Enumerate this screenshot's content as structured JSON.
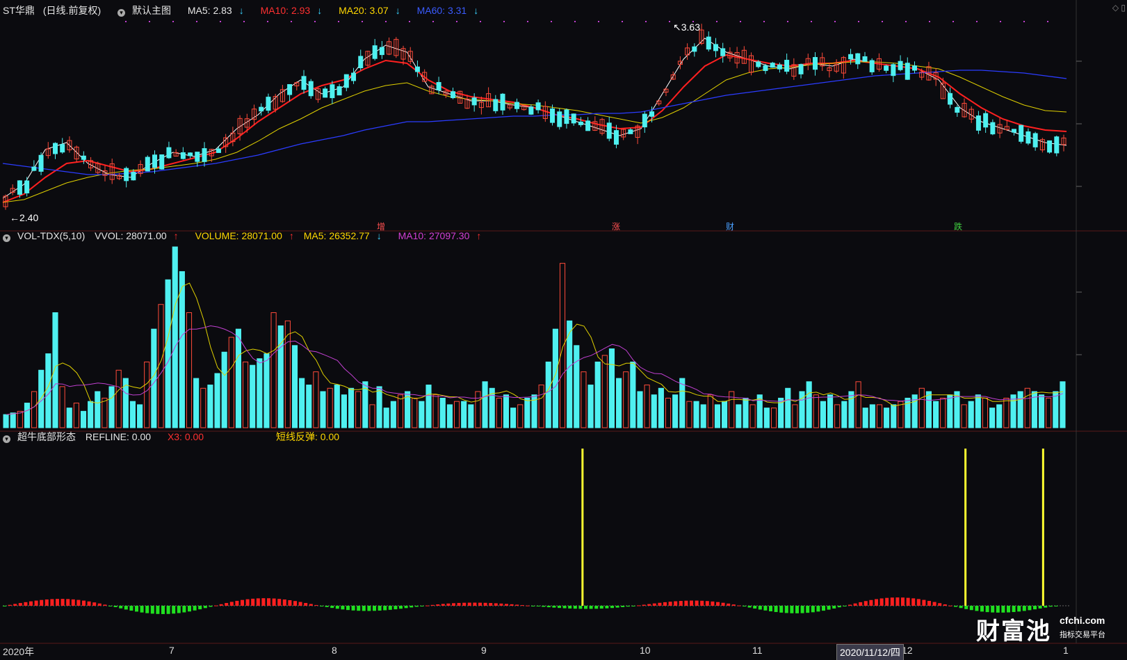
{
  "header_main": {
    "stock": "ST华鼎",
    "period": "(日线.前复权)",
    "template": "默认主图",
    "ma5": "MA5: 2.83",
    "ma10": "MA10: 2.93",
    "ma20": "MA20: 3.07",
    "ma60": "MA60: 3.31"
  },
  "header_vol": {
    "name": "VOL-TDX(5,10)",
    "vvol": "VVOL: 28071.00",
    "volume": "VOLUME: 28071.00",
    "ma5": "MA5: 26352.77",
    "ma10": "MA10: 27097.30"
  },
  "header_ind": {
    "name": "超牛底部形态",
    "refline": "REFLINE: 0.00",
    "x3": "X3: 0.00",
    "rebound": "短线反弹: 0.00"
  },
  "price_labels": {
    "low": "2.40",
    "high": "3.63"
  },
  "event_marks": [
    {
      "text": "增",
      "color": "#ff5050"
    },
    {
      "text": "涨",
      "color": "#ff5050"
    },
    {
      "text": "财",
      "color": "#4aa0ff"
    },
    {
      "text": "跌",
      "color": "#40d040"
    }
  ],
  "x_axis": {
    "year": "2020年",
    "months": [
      "7",
      "8",
      "9",
      "10",
      "11",
      "12",
      "1"
    ]
  },
  "crosshair_date": "2020/11/12/四",
  "watermark": {
    "brand": "财富池",
    "url": "cfchi.com",
    "slogan": "指标交易平台"
  },
  "colors": {
    "up": "#ff4b3a",
    "down": "#4ff0f0",
    "ma5": "#ffffff",
    "ma10": "#ff2020",
    "ma20": "#e0d000",
    "ma60": "#2b3cff",
    "vol_ma5": "#e0d000",
    "vol_ma10": "#c040d0",
    "signal": "#ffff30",
    "osc_pos": "#ff2020",
    "osc_neg": "#20e020"
  },
  "chart_data": [
    {
      "type": "line",
      "name": "main-price-chart",
      "title": "ST华鼎 (日线.前复权)",
      "series": [
        {
          "name": "MA5",
          "values": [
            2.45,
            2.55,
            2.8,
            2.85,
            2.7,
            2.62,
            2.6,
            2.7,
            2.78,
            2.75,
            2.8,
            2.95,
            3.05,
            3.2,
            3.3,
            3.2,
            3.25,
            3.45,
            3.55,
            3.5,
            3.25,
            3.2,
            3.15,
            3.15,
            3.12,
            3.1,
            3.05,
            3.0,
            2.95,
            2.9,
            2.95,
            3.2,
            3.45,
            3.6,
            3.5,
            3.45,
            3.4,
            3.38,
            3.42,
            3.4,
            3.45,
            3.42,
            3.4,
            3.38,
            3.3,
            3.1,
            3.0,
            2.95,
            2.9,
            2.85,
            2.83
          ]
        },
        {
          "name": "MA10",
          "values": [
            2.42,
            2.48,
            2.6,
            2.7,
            2.72,
            2.68,
            2.64,
            2.66,
            2.7,
            2.74,
            2.78,
            2.88,
            3.0,
            3.1,
            3.2,
            3.26,
            3.3,
            3.38,
            3.44,
            3.42,
            3.3,
            3.22,
            3.18,
            3.16,
            3.14,
            3.1,
            3.05,
            3.02,
            2.98,
            2.95,
            2.96,
            3.08,
            3.25,
            3.4,
            3.48,
            3.45,
            3.42,
            3.4,
            3.42,
            3.42,
            3.44,
            3.42,
            3.4,
            3.38,
            3.32,
            3.2,
            3.1,
            3.02,
            2.97,
            2.94,
            2.93
          ]
        },
        {
          "name": "MA20",
          "values": [
            2.42,
            2.44,
            2.5,
            2.56,
            2.6,
            2.63,
            2.65,
            2.66,
            2.68,
            2.7,
            2.73,
            2.78,
            2.86,
            2.95,
            3.02,
            3.1,
            3.16,
            3.22,
            3.26,
            3.28,
            3.22,
            3.18,
            3.16,
            3.15,
            3.13,
            3.12,
            3.1,
            3.08,
            3.05,
            3.02,
            2.99,
            3.03,
            3.1,
            3.2,
            3.3,
            3.35,
            3.38,
            3.39,
            3.41,
            3.42,
            3.43,
            3.43,
            3.42,
            3.4,
            3.38,
            3.32,
            3.25,
            3.18,
            3.12,
            3.08,
            3.07
          ]
        },
        {
          "name": "MA60",
          "values": [
            2.7,
            2.68,
            2.66,
            2.64,
            2.62,
            2.62,
            2.63,
            2.64,
            2.66,
            2.68,
            2.7,
            2.73,
            2.76,
            2.8,
            2.84,
            2.87,
            2.9,
            2.94,
            2.97,
            3.0,
            3.0,
            3.01,
            3.02,
            3.03,
            3.04,
            3.04,
            3.05,
            3.05,
            3.06,
            3.06,
            3.07,
            3.1,
            3.13,
            3.16,
            3.19,
            3.21,
            3.23,
            3.25,
            3.27,
            3.29,
            3.31,
            3.33,
            3.34,
            3.35,
            3.36,
            3.37,
            3.37,
            3.36,
            3.35,
            3.33,
            3.31
          ]
        }
      ],
      "ylim": [
        2.35,
        3.7
      ]
    },
    {
      "type": "bar",
      "name": "volume-chart",
      "title": "VOL-TDX(5,10)",
      "values": [
        8,
        9,
        10,
        15,
        22,
        35,
        45,
        70,
        25,
        12,
        15,
        10,
        16,
        22,
        18,
        25,
        35,
        30,
        16,
        14,
        40,
        60,
        75,
        90,
        110,
        95,
        70,
        30,
        24,
        26,
        33,
        46,
        55,
        60,
        40,
        38,
        42,
        45,
        70,
        62,
        65,
        50,
        30,
        26,
        34,
        22,
        24,
        26,
        20,
        24,
        22,
        28,
        14,
        25,
        12,
        16,
        20,
        22,
        18,
        16,
        26,
        20,
        18,
        14,
        16,
        16,
        14,
        22,
        28,
        24,
        18,
        20,
        12,
        14,
        18,
        20,
        26,
        40,
        60,
        100,
        65,
        50,
        34,
        26,
        40,
        44,
        48,
        30,
        34,
        40,
        22,
        26,
        20,
        24,
        18,
        20,
        30,
        16,
        16,
        14,
        20,
        14,
        16,
        22,
        14,
        18,
        14,
        20,
        12,
        12,
        18,
        24,
        14,
        22,
        28,
        20,
        16,
        20,
        14,
        16,
        22,
        28,
        12,
        14,
        14,
        12,
        14,
        16,
        18,
        20,
        24,
        22,
        16,
        18,
        20,
        22,
        14,
        16,
        20,
        18,
        12,
        14,
        18,
        20,
        22,
        24,
        22,
        20,
        18,
        22,
        28
      ],
      "ylim": [
        0,
        110
      ]
    },
    {
      "type": "bar",
      "name": "bottom-pattern-indicator",
      "title": "超牛底部形态",
      "signals_index": [
        0.545,
        0.905,
        0.978
      ]
    }
  ]
}
